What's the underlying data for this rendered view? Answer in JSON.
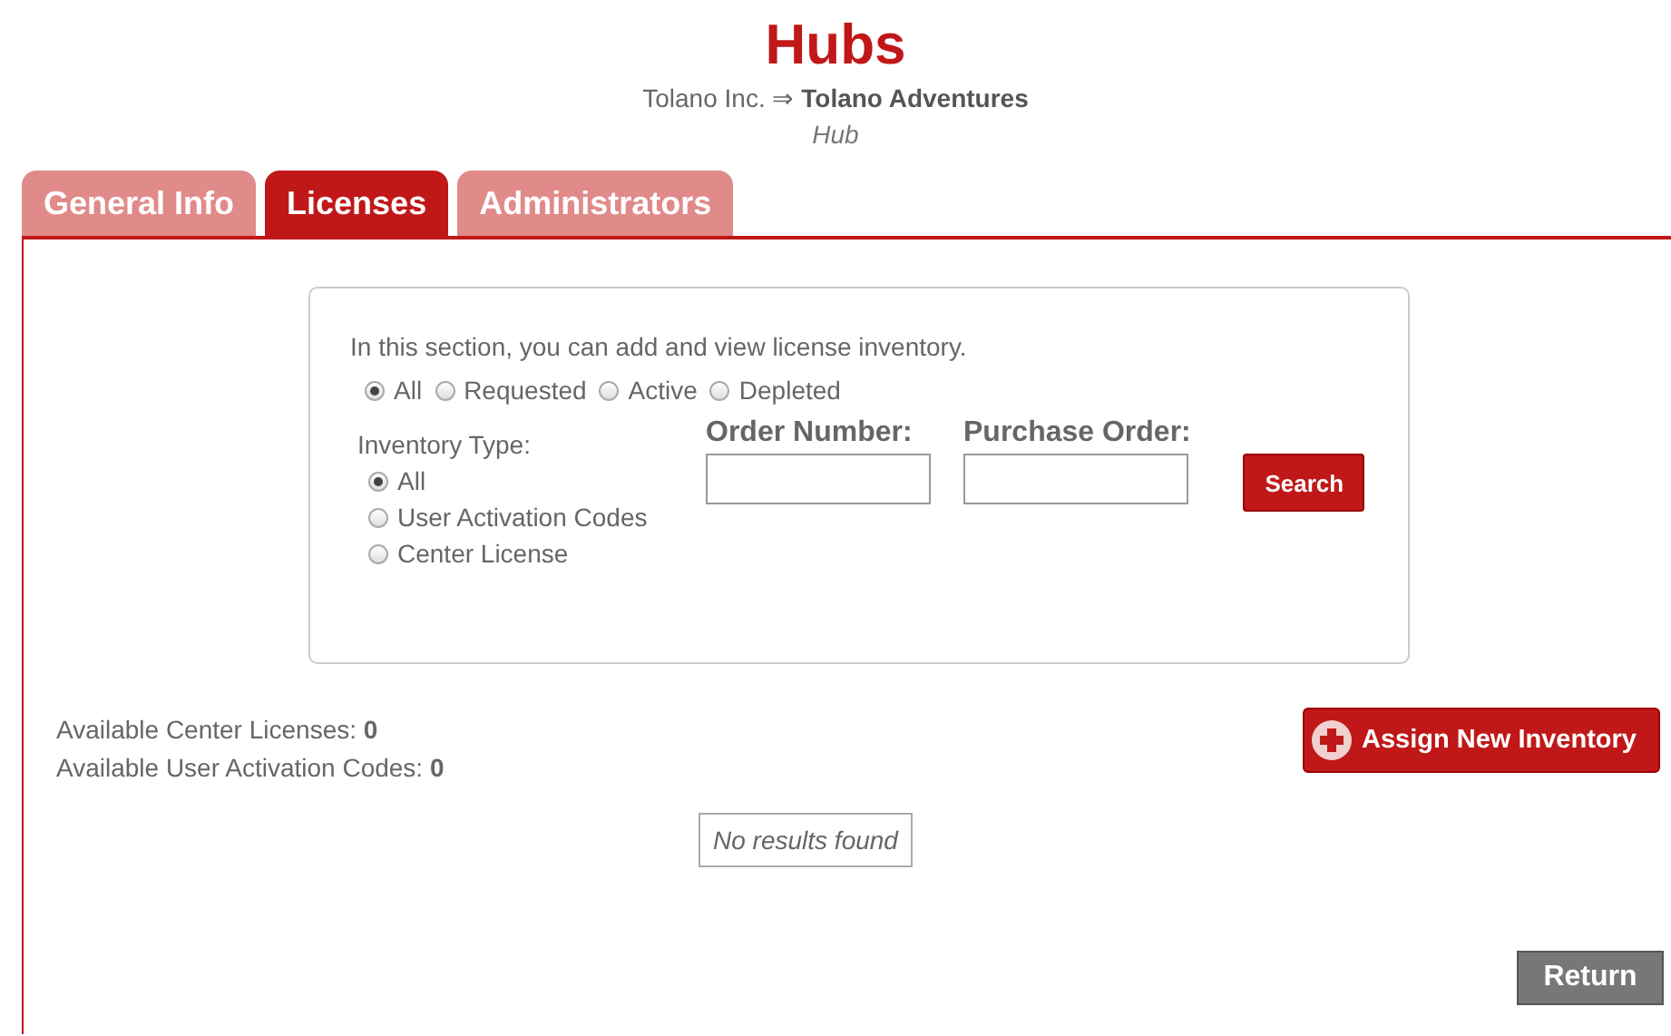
{
  "title": "Hubs",
  "breadcrumb": "Tolano Inc. ⇒ **Tolano Adventures**",
  "subtitle": "Hub",
  "tabs": [
    {
      "label": "General Info",
      "selected": false
    },
    {
      "label": "Licenses",
      "selected": true
    },
    {
      "label": "Administrators",
      "selected": false
    }
  ],
  "intro": "In this section, you can add and view license inventory.",
  "status_filter": [
    {
      "label": "All",
      "selected": true
    },
    {
      "label": "Requested",
      "selected": false
    },
    {
      "label": "Active",
      "selected": false
    },
    {
      "label": "Depleted",
      "selected": false
    }
  ],
  "inventory_type": {
    "label": "Inventory Type:",
    "options": [
      {
        "label": "All",
        "selected": true
      },
      {
        "label": "User Activation Codes",
        "selected": false
      },
      {
        "label": "Center License",
        "selected": false
      }
    ]
  },
  "fields": [
    {
      "label": "Order Number:"
    },
    {
      "label": "Purchase Order:"
    }
  ],
  "search_button": "Search",
  "counts": [
    "Available Center Licenses: **0**",
    "Available User Activation Codes: **0**"
  ],
  "assign_button": "Assign New Inventory",
  "empty_message": "No results found",
  "return_button": "Return"
}
